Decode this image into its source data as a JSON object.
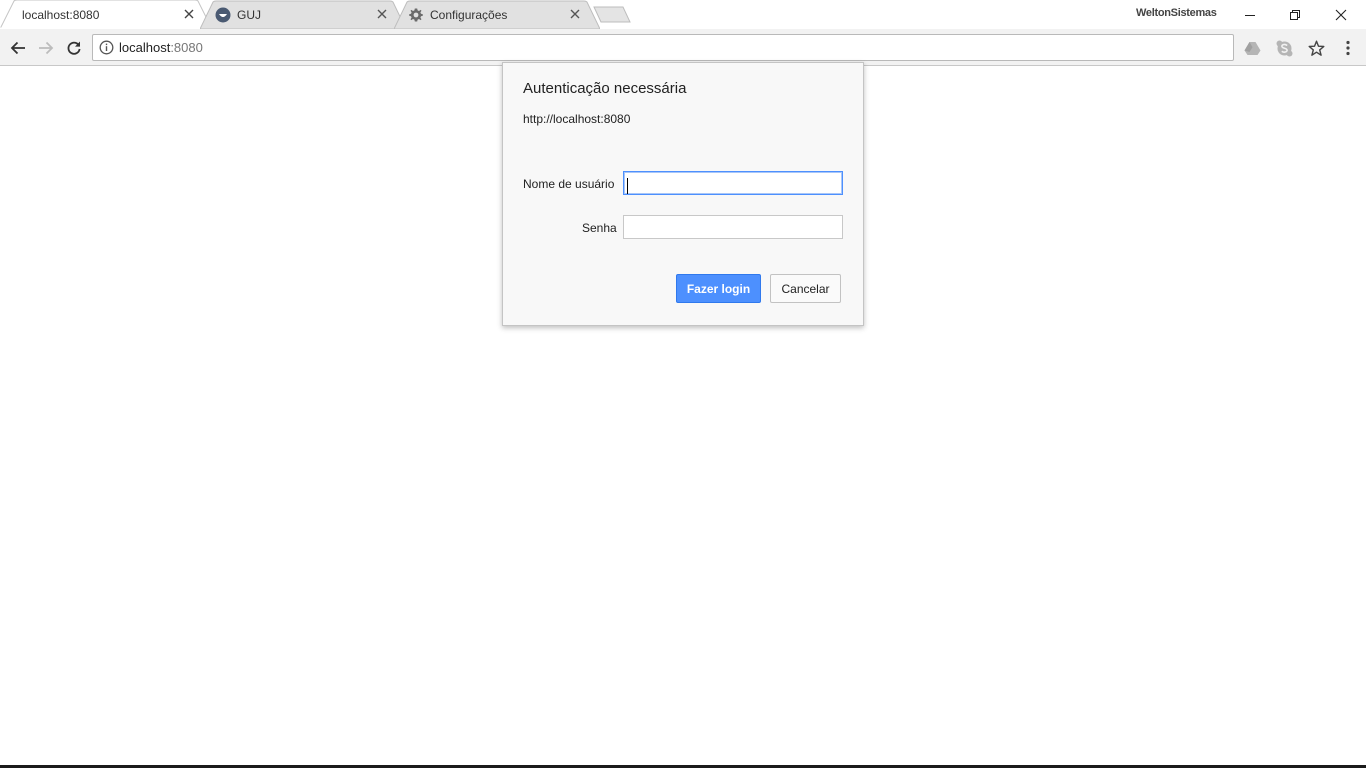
{
  "browser": {
    "tabs": [
      {
        "title": "localhost:8080",
        "active": true,
        "icon": "none"
      },
      {
        "title": "GUJ",
        "active": false,
        "icon": "guj-favicon"
      },
      {
        "title": "Configurações",
        "active": false,
        "icon": "gear-icon"
      }
    ],
    "profile_name": "WeltonSistemas",
    "address": {
      "host": "localhost",
      "port": ":8080"
    },
    "extensions": [
      "drive-icon",
      "skype-icon"
    ],
    "colors": {
      "accent": "#4d90fe",
      "toolbar": "#f2f2f2",
      "dialog_bg": "#f8f8f8"
    }
  },
  "dialog": {
    "title": "Autenticação necessária",
    "origin": "http://localhost:8080",
    "username_label": "Nome de usuário",
    "username_value": "",
    "password_label": "Senha",
    "password_value": "",
    "login_button": "Fazer login",
    "cancel_button": "Cancelar"
  }
}
